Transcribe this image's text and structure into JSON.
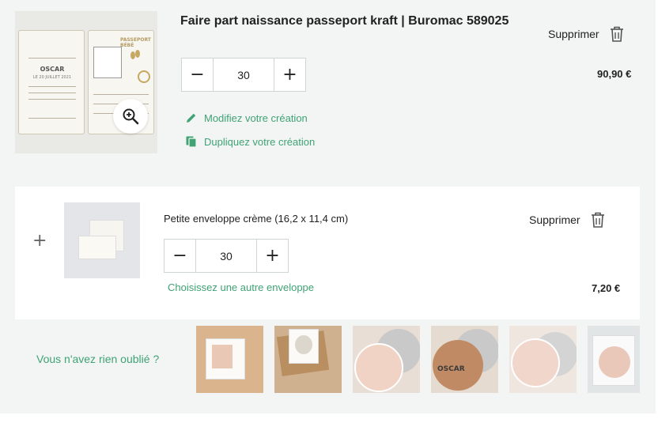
{
  "product": {
    "title": "Faire part naissance passeport kraft | Buromac 589025",
    "quantity": "30",
    "price": "90,90 €",
    "remove_label": "Supprimer",
    "edit_label": "Modifiez votre création",
    "duplicate_label": "Dupliquez votre création",
    "image": {
      "name": "OSCAR",
      "date": "LE 20 JUILLET 2021",
      "card_title": "PASSEPORT BÉBÉ"
    }
  },
  "envelope": {
    "title": "Petite enveloppe crème (16,2 x 11,4 cm)",
    "quantity": "30",
    "price": "7,20 €",
    "remove_label": "Supprimer",
    "change_label": "Choisissez une autre enveloppe",
    "plus": "+"
  },
  "extras": {
    "label": "Vous n'avez rien oublié ?",
    "thumb_text": "OSCAR"
  },
  "colors": {
    "accent": "#3fa374",
    "panel_bg": "#f3f4f4"
  },
  "icons": {
    "minus": "−",
    "plus": "+"
  }
}
